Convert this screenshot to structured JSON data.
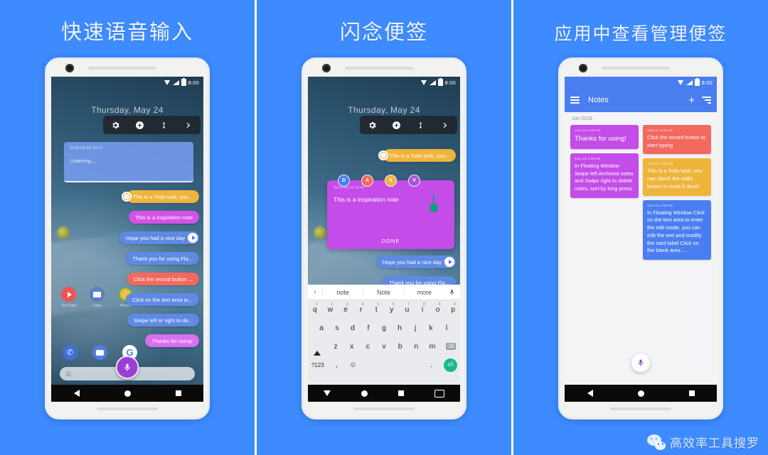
{
  "background_color": "#3d8bff",
  "panels": [
    {
      "title": "快速语音输入",
      "status": {
        "time": "8:00",
        "wifi_icon": "wifi-icon",
        "signal_icon": "signal-icon",
        "battery_icon": "battery-icon"
      },
      "home": {
        "date": "Thursday, May 24",
        "toolbar_icons": [
          "gear-icon",
          "plus-circle-icon",
          "resize-vertical-icon",
          "chevron-right-icon"
        ],
        "listening_card": {
          "timestamp": "2018-05-24 13:12",
          "text": "Listening..."
        },
        "pills": [
          {
            "text": "This is a Todo task, you...",
            "color": "#efb43c",
            "toggle": true
          },
          {
            "text": "This is a  inspiration note",
            "color": "#d552e8",
            "toggle": false
          },
          {
            "text": "Hope you had a nice day",
            "color": "#5f8ae4",
            "play": true
          },
          {
            "text": "Thank you for using Fla...",
            "color": "#5f8ae4"
          },
          {
            "text": "Click the record button ...",
            "color": "#f2695f"
          },
          {
            "text": "Click on the text area to...",
            "color": "#5f8ae4"
          },
          {
            "text": "Swipe left or right to de...",
            "color": "#5f8ae4"
          },
          {
            "text": "Thanks for using!",
            "color": "#da6ef0"
          }
        ],
        "apps": [
          {
            "label": "YouTube",
            "icon": "youtube-icon"
          },
          {
            "label": "Files",
            "icon": "files-icon"
          },
          {
            "label": "Photos",
            "icon": "photos-icon"
          }
        ],
        "dock": [
          "phone-icon",
          "messages-icon",
          "google-icon"
        ],
        "search_placeholder": "G",
        "mic_label": "mic-icon",
        "nav": [
          "back-icon",
          "home-icon",
          "recents-icon"
        ]
      }
    },
    {
      "title": "闪念便签",
      "status": {
        "time": "8:00"
      },
      "home": {
        "date": "Thursday, May 24",
        "toolbar_icons": [
          "gear-icon",
          "plus-circle-icon",
          "resize-vertical-icon",
          "chevron-right-icon"
        ],
        "todo_pill": {
          "text": "This is a Todo task, you...",
          "color": "#efb43c"
        },
        "badges": [
          {
            "letter": "D",
            "color": "#4a7ef0"
          },
          {
            "letter": "A",
            "color": "#f2695f"
          },
          {
            "letter": "S",
            "color": "#efb43c"
          },
          {
            "letter": "V",
            "color": "#a855d6"
          }
        ],
        "edit_card": {
          "timestamp": "2018-05-24 12:40",
          "text": "This is a  inspiration note",
          "done_label": "DONE",
          "color": "#c44ce8"
        },
        "pills": [
          {
            "text": "Hope you had a nice day",
            "color": "#5f8ae4",
            "play": true
          },
          {
            "text": "Thank you for using Fla...",
            "color": "#5f8ae4"
          }
        ],
        "nav": [
          "back-icon",
          "home-icon",
          "recents-icon",
          "keyboard-icon"
        ]
      },
      "keyboard": {
        "suggestions": [
          "note",
          "Note",
          "more"
        ],
        "expand_icon": "chevron-right-icon",
        "mic_icon": "mic-icon",
        "row1": [
          {
            "k": "q",
            "n": "1"
          },
          {
            "k": "w",
            "n": "2"
          },
          {
            "k": "e",
            "n": "3"
          },
          {
            "k": "r",
            "n": "4"
          },
          {
            "k": "t",
            "n": "5"
          },
          {
            "k": "y",
            "n": "6"
          },
          {
            "k": "u",
            "n": "7"
          },
          {
            "k": "i",
            "n": "8"
          },
          {
            "k": "o",
            "n": "9"
          },
          {
            "k": "p",
            "n": "0"
          }
        ],
        "row2": [
          "a",
          "s",
          "d",
          "f",
          "g",
          "h",
          "j",
          "k",
          "l"
        ],
        "row3": [
          "z",
          "x",
          "c",
          "v",
          "b",
          "n",
          "m"
        ],
        "shift_icon": "shift-icon",
        "backspace_icon": "backspace-icon",
        "num_key": "?123",
        "comma_key": ",",
        "emoji_icon": "emoji-icon",
        "period_key": ".",
        "enter_icon": "enter-icon"
      }
    },
    {
      "title": "应用中查看管理便签",
      "status": {
        "time": "8:00"
      },
      "appbar": {
        "menu_icon": "hamburger-icon",
        "title": "Notes",
        "add_icon": "plus-icon",
        "sort_icon": "sort-icon"
      },
      "month_label": "Jun 2018",
      "cards": [
        {
          "timestamp": "June 10, 9:36 AM",
          "text": "Thanks for using!",
          "color": "#c44ce8",
          "big": true,
          "col": 0
        },
        {
          "timestamp": "June 10, 9:34 AM",
          "text": "In Floating Window Swipe left Archived notes and Swipe right to delete notes, sort by long press",
          "color": "#c44ce8",
          "col": 0
        },
        {
          "timestamp": "June 10, 9:35 AM",
          "text": "Click the record button to start typing",
          "color": "#f2695f",
          "col": 1
        },
        {
          "timestamp": "June 10, 9:35 AM",
          "text": "This is a Todo task, you can check the radio button to mark it done!",
          "color": "#efb43c",
          "col": 1
        },
        {
          "timestamp": "June 10, 9:34 AM",
          "text": "In Floating Window Click on the text area to enter the edit mode, you can edit the text and modify the card label Click on the blank area ...",
          "color": "#4a7ef0",
          "col": 1
        }
      ],
      "mic_label": "mic-icon",
      "nav": [
        "back-icon",
        "home-icon",
        "recents-icon"
      ]
    }
  ],
  "watermark": {
    "text": "高效率工具搜罗",
    "icon": "wechat-icon"
  }
}
